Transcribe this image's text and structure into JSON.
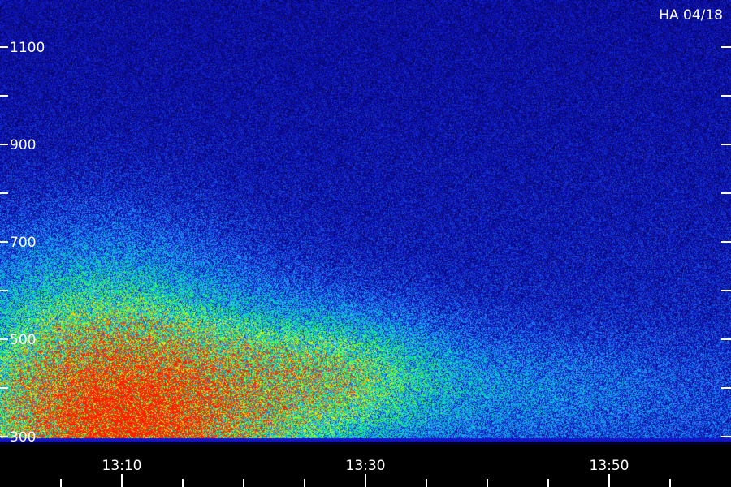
{
  "chart_data": {
    "type": "heatmap",
    "title": "HA 04/18",
    "xlabel": "",
    "ylabel": "",
    "x_tick_labels": [
      "13:10",
      "13:30",
      "13:50"
    ],
    "x_range": [
      "13:00",
      "14:00"
    ],
    "y_tick_labels": [
      "300",
      "500",
      "700",
      "900",
      "1100"
    ],
    "y_range": [
      300,
      1180
    ],
    "colormap": [
      "#000030",
      "#1010c0",
      "#1e90ff",
      "#00e0c0",
      "#40ff40",
      "#ffff00",
      "#ff2000"
    ],
    "intensity_blobs": [
      {
        "t_min": 10,
        "value_center": 330,
        "value_spread": 80,
        "time_spread": 5,
        "peak": 1.0
      },
      {
        "t_min": 8,
        "value_center": 420,
        "value_spread": 170,
        "time_spread": 8,
        "peak": 0.7
      },
      {
        "t_min": 20,
        "value_center": 380,
        "value_spread": 110,
        "time_spread": 8,
        "peak": 0.45
      },
      {
        "t_min": 28,
        "value_center": 440,
        "value_spread": 80,
        "time_spread": 6,
        "peak": 0.3
      },
      {
        "t_min": 42,
        "value_center": 400,
        "value_spread": 70,
        "time_spread": 10,
        "peak": 0.15
      }
    ],
    "background_level": 0.18,
    "noise": "speckle"
  }
}
